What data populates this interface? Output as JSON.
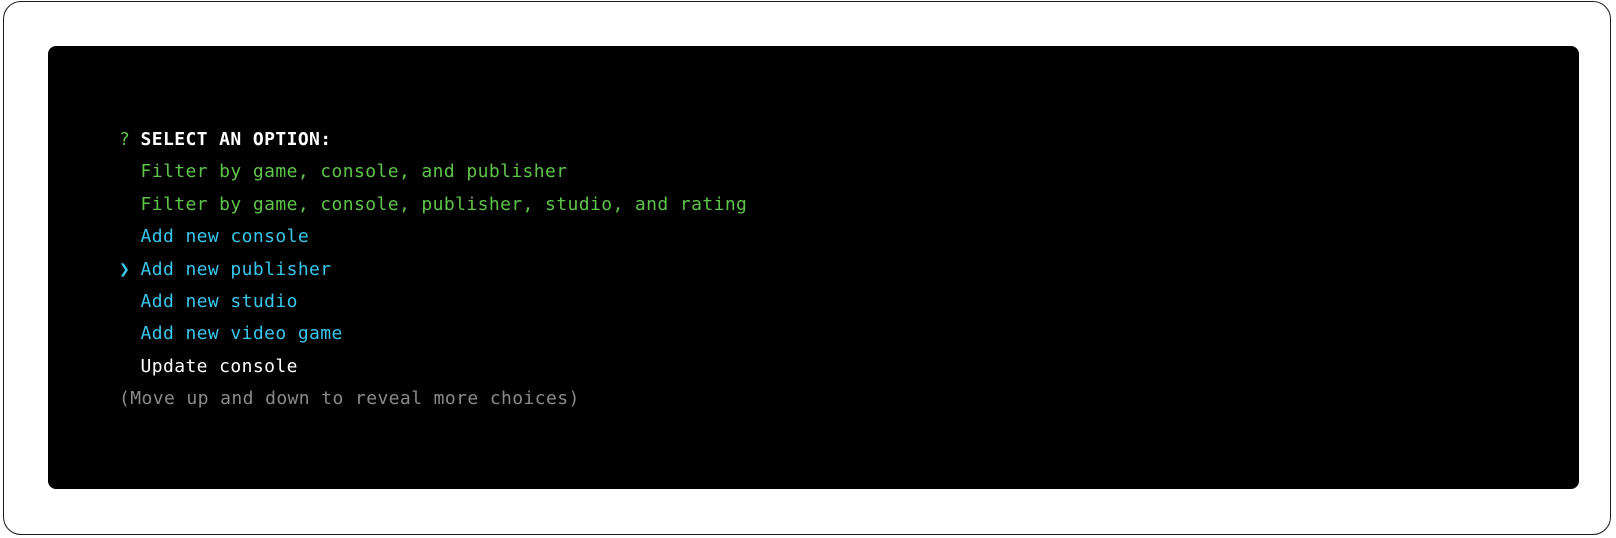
{
  "prompt": {
    "marker": "?",
    "title": "SELECT AN OPTION:"
  },
  "pointer_glyph": "❯",
  "options": [
    {
      "label": "Filter by game, console, and publisher",
      "color": "#5fc44a",
      "selected": false
    },
    {
      "label": "Filter by game, console, publisher, studio, and rating",
      "color": "#5fc44a",
      "selected": false
    },
    {
      "label": "Add new console",
      "color": "#38c6ec",
      "selected": false
    },
    {
      "label": "Add new publisher",
      "color": "#38c6ec",
      "selected": true
    },
    {
      "label": "Add new studio",
      "color": "#38c6ec",
      "selected": false
    },
    {
      "label": "Add new video game",
      "color": "#38c6ec",
      "selected": false
    },
    {
      "label": "Update console",
      "color": "#ffffff",
      "selected": false
    }
  ],
  "hint": "(Move up and down to reveal more choices)",
  "colors": {
    "terminal_bg": "#000000",
    "prompt_marker": "#5fc44a",
    "hint": "#8a8a8a"
  }
}
